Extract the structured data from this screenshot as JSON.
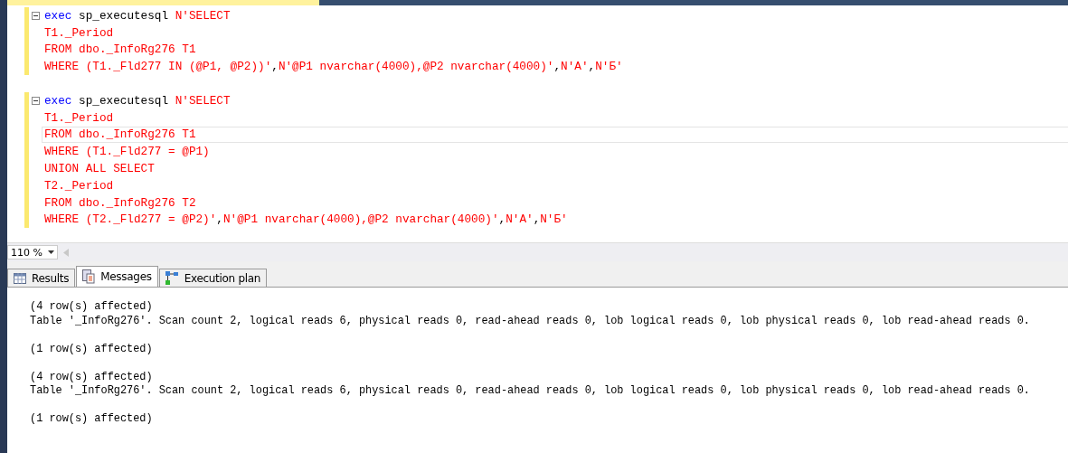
{
  "editor": {
    "blocks": [
      {
        "lines": [
          {
            "current": false,
            "segments": [
              {
                "kind": "keyword",
                "text": "exec"
              },
              {
                "kind": "plain",
                "text": " sp_executesql "
              },
              {
                "kind": "string",
                "text": "N'SELECT"
              }
            ]
          },
          {
            "current": false,
            "segments": [
              {
                "kind": "string",
                "text": "T1._Period"
              }
            ]
          },
          {
            "current": false,
            "segments": [
              {
                "kind": "string",
                "text": "FROM dbo._InfoRg276 T1"
              }
            ]
          },
          {
            "current": false,
            "segments": [
              {
                "kind": "string",
                "text": "WHERE (T1._Fld277 IN (@P1, @P2))'"
              },
              {
                "kind": "plain",
                "text": ","
              },
              {
                "kind": "string",
                "text": "N'@P1 nvarchar(4000),@P2 nvarchar(4000)'"
              },
              {
                "kind": "plain",
                "text": ","
              },
              {
                "kind": "string",
                "text": "N'А'"
              },
              {
                "kind": "plain",
                "text": ","
              },
              {
                "kind": "string",
                "text": "N'Б'"
              }
            ]
          }
        ]
      },
      {
        "lines": [
          {
            "current": false,
            "segments": [
              {
                "kind": "keyword",
                "text": "exec"
              },
              {
                "kind": "plain",
                "text": " sp_executesql "
              },
              {
                "kind": "string",
                "text": "N'SELECT"
              }
            ]
          },
          {
            "current": false,
            "segments": [
              {
                "kind": "string",
                "text": "T1._Period"
              }
            ]
          },
          {
            "current": true,
            "segments": [
              {
                "kind": "string",
                "text": "FROM dbo._InfoRg276 T1"
              }
            ]
          },
          {
            "current": false,
            "segments": [
              {
                "kind": "string",
                "text": "WHERE (T1._Fld277 = @P1)"
              }
            ]
          },
          {
            "current": false,
            "segments": [
              {
                "kind": "string",
                "text": "UNION ALL SELECT"
              }
            ]
          },
          {
            "current": false,
            "segments": [
              {
                "kind": "string",
                "text": "T2._Period"
              }
            ]
          },
          {
            "current": false,
            "segments": [
              {
                "kind": "string",
                "text": "FROM dbo._InfoRg276 T2"
              }
            ]
          },
          {
            "current": false,
            "segments": [
              {
                "kind": "string",
                "text": "WHERE (T2._Fld277 = @P2)'"
              },
              {
                "kind": "plain",
                "text": ","
              },
              {
                "kind": "string",
                "text": "N'@P1 nvarchar(4000),@P2 nvarchar(4000)'"
              },
              {
                "kind": "plain",
                "text": ","
              },
              {
                "kind": "string",
                "text": "N'А'"
              },
              {
                "kind": "plain",
                "text": ","
              },
              {
                "kind": "string",
                "text": "N'Б'"
              }
            ]
          }
        ]
      }
    ]
  },
  "zoom": {
    "value": "110 %"
  },
  "result_tabs": [
    {
      "kind": "grid",
      "label": "Results",
      "selected": false
    },
    {
      "kind": "messages",
      "label": "Messages",
      "selected": true
    },
    {
      "kind": "plan",
      "label": "Execution plan",
      "selected": false
    }
  ],
  "messages": [
    {
      "lines": [
        "(4 row(s) affected)",
        "Table '_InfoRg276'. Scan count 2, logical reads 6, physical reads 0, read-ahead reads 0, lob logical reads 0, lob physical reads 0, lob read-ahead reads 0."
      ]
    },
    {
      "lines": [
        "(1 row(s) affected)"
      ]
    },
    {
      "lines": [
        "(4 row(s) affected)",
        "Table '_InfoRg276'. Scan count 2, logical reads 6, physical reads 0, read-ahead reads 0, lob logical reads 0, lob physical reads 0, lob read-ahead reads 0."
      ]
    },
    {
      "lines": [
        "(1 row(s) affected)"
      ]
    }
  ]
}
